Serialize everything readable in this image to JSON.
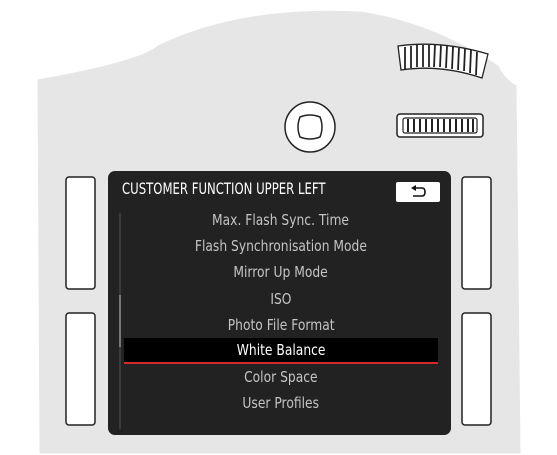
{
  "screen": {
    "title": "CUSTOMER FUNCTION UPPER LEFT",
    "back_icon": "back-arrow-icon",
    "items": [
      {
        "label": "Max. Flash Sync. Time",
        "selected": false
      },
      {
        "label": "Flash Synchronisation Mode",
        "selected": false
      },
      {
        "label": "Mirror Up Mode",
        "selected": false
      },
      {
        "label": "ISO",
        "selected": false
      },
      {
        "label": "Photo File Format",
        "selected": false
      },
      {
        "label": "White Balance",
        "selected": true
      },
      {
        "label": "Color Space",
        "selected": false
      },
      {
        "label": "User Profiles",
        "selected": false
      }
    ]
  },
  "colors": {
    "body": "#e6e6e6",
    "screen_bg": "#222222",
    "selection_bg": "#000000",
    "selection_underline": "#d42a2a"
  }
}
